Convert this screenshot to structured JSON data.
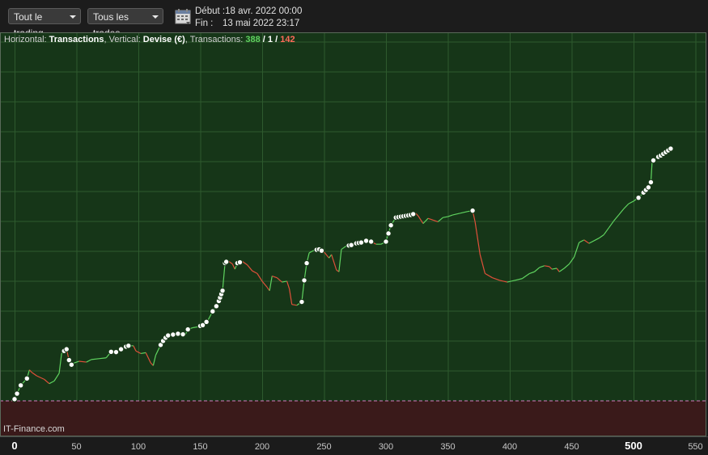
{
  "toolbar": {
    "trading_filter": "Tout le trading",
    "trades_filter": "Tous les trades",
    "start_label": "Début :",
    "start_value": "18 avr. 2022 00:00",
    "end_label": "Fin :",
    "end_value": "13 mai 2022 23:17"
  },
  "legend": {
    "h_label": "Horizontal: ",
    "h_value": "Transactions",
    "v_label": ", Vertical: ",
    "v_value": "Devise (€)",
    "t_label": ", Transactions: ",
    "wins": "388",
    "sep": " / ",
    "neutral": "1",
    "losses": "142"
  },
  "credit": "IT-Finance.com",
  "colors": {
    "background": "#163618",
    "negative_zone": "#3a1a1a",
    "rise": "#5fd35f",
    "fall": "#e0503a",
    "marker": "#ffffff"
  },
  "chart_data": {
    "type": "line",
    "xlabel": "",
    "ylabel": "",
    "xlim": [
      -10,
      560
    ],
    "x_ticks": [
      0,
      50,
      100,
      150,
      200,
      250,
      300,
      350,
      400,
      450,
      500,
      550
    ],
    "ylim": [
      -3,
      40
    ],
    "zero_line": 0,
    "grid": true,
    "points": [
      [
        0,
        0.2
      ],
      [
        5,
        1.8
      ],
      [
        10,
        2.6
      ],
      [
        12,
        3.6
      ],
      [
        14,
        3.3
      ],
      [
        18,
        2.9
      ],
      [
        24,
        2.5
      ],
      [
        28,
        2.0
      ],
      [
        32,
        2.3
      ],
      [
        36,
        3.2
      ],
      [
        38,
        5.5
      ],
      [
        40,
        5.8
      ],
      [
        42,
        6.0
      ],
      [
        45,
        4.1
      ],
      [
        48,
        4.4
      ],
      [
        52,
        4.6
      ],
      [
        58,
        4.5
      ],
      [
        62,
        4.8
      ],
      [
        68,
        4.9
      ],
      [
        74,
        5.0
      ],
      [
        78,
        5.7
      ],
      [
        80,
        5.5
      ],
      [
        86,
        6.0
      ],
      [
        90,
        6.3
      ],
      [
        92,
        6.4
      ],
      [
        96,
        6.4
      ],
      [
        98,
        5.8
      ],
      [
        102,
        5.5
      ],
      [
        106,
        5.6
      ],
      [
        110,
        4.4
      ],
      [
        112,
        4.1
      ],
      [
        114,
        5.3
      ],
      [
        118,
        6.5
      ],
      [
        121,
        7.2
      ],
      [
        124,
        7.6
      ],
      [
        128,
        7.7
      ],
      [
        132,
        7.8
      ],
      [
        138,
        7.7
      ],
      [
        140,
        8.3
      ],
      [
        144,
        8.5
      ],
      [
        148,
        8.6
      ],
      [
        152,
        8.8
      ],
      [
        156,
        9.3
      ],
      [
        160,
        10.4
      ],
      [
        164,
        11.2
      ],
      [
        168,
        12.8
      ],
      [
        170,
        16.0
      ],
      [
        172,
        16.3
      ],
      [
        176,
        15.9
      ],
      [
        178,
        15.3
      ],
      [
        180,
        16.0
      ],
      [
        184,
        16.2
      ],
      [
        188,
        15.8
      ],
      [
        192,
        15.1
      ],
      [
        196,
        14.8
      ],
      [
        200,
        13.9
      ],
      [
        204,
        13.2
      ],
      [
        206,
        12.8
      ],
      [
        208,
        14.5
      ],
      [
        212,
        14.3
      ],
      [
        216,
        13.8
      ],
      [
        220,
        13.9
      ],
      [
        222,
        13.0
      ],
      [
        224,
        11.2
      ],
      [
        228,
        11.1
      ],
      [
        232,
        11.5
      ],
      [
        234,
        14.0
      ],
      [
        236,
        16.0
      ],
      [
        238,
        17.2
      ],
      [
        242,
        17.5
      ],
      [
        246,
        17.6
      ],
      [
        250,
        17.3
      ],
      [
        254,
        16.6
      ],
      [
        256,
        17.0
      ],
      [
        260,
        15.2
      ],
      [
        262,
        15.0
      ],
      [
        264,
        17.6
      ],
      [
        268,
        18.0
      ],
      [
        272,
        18.1
      ],
      [
        276,
        18.3
      ],
      [
        280,
        18.4
      ],
      [
        284,
        18.6
      ],
      [
        288,
        18.5
      ],
      [
        292,
        18.2
      ],
      [
        296,
        18.2
      ],
      [
        300,
        18.5
      ],
      [
        304,
        20.4
      ],
      [
        308,
        21.3
      ],
      [
        312,
        21.4
      ],
      [
        316,
        21.5
      ],
      [
        320,
        21.6
      ],
      [
        324,
        21.8
      ],
      [
        326,
        21.5
      ],
      [
        330,
        20.6
      ],
      [
        334,
        21.2
      ],
      [
        338,
        21.0
      ],
      [
        342,
        20.8
      ],
      [
        346,
        21.3
      ],
      [
        350,
        21.4
      ],
      [
        354,
        21.6
      ],
      [
        360,
        21.8
      ],
      [
        366,
        22.0
      ],
      [
        370,
        22.1
      ],
      [
        372,
        20.8
      ],
      [
        376,
        17.0
      ],
      [
        380,
        14.8
      ],
      [
        386,
        14.3
      ],
      [
        392,
        14.0
      ],
      [
        398,
        13.8
      ],
      [
        404,
        14.0
      ],
      [
        410,
        14.2
      ],
      [
        416,
        14.8
      ],
      [
        420,
        15.0
      ],
      [
        424,
        15.5
      ],
      [
        428,
        15.7
      ],
      [
        432,
        15.6
      ],
      [
        434,
        15.3
      ],
      [
        438,
        15.4
      ],
      [
        440,
        15.0
      ],
      [
        444,
        15.4
      ],
      [
        448,
        15.9
      ],
      [
        452,
        16.7
      ],
      [
        456,
        18.4
      ],
      [
        460,
        18.7
      ],
      [
        464,
        18.3
      ],
      [
        468,
        18.6
      ],
      [
        472,
        18.9
      ],
      [
        476,
        19.3
      ],
      [
        480,
        20.1
      ],
      [
        484,
        20.9
      ],
      [
        488,
        21.6
      ],
      [
        492,
        22.3
      ],
      [
        496,
        22.9
      ],
      [
        500,
        23.2
      ],
      [
        504,
        23.6
      ],
      [
        508,
        24.2
      ],
      [
        512,
        24.8
      ],
      [
        514,
        25.4
      ],
      [
        515,
        27.8
      ],
      [
        518,
        28.2
      ],
      [
        522,
        28.5
      ],
      [
        526,
        28.9
      ],
      [
        530,
        29.3
      ]
    ],
    "markers": [
      0,
      2,
      5,
      10,
      40,
      42,
      44,
      46,
      78,
      82,
      86,
      90,
      92,
      118,
      120,
      122,
      124,
      128,
      132,
      136,
      140,
      150,
      152,
      155,
      160,
      163,
      165,
      166,
      167,
      168,
      170,
      171,
      180,
      182,
      232,
      234,
      236,
      244,
      246,
      248,
      270,
      272,
      276,
      278,
      280,
      284,
      288,
      300,
      302,
      304,
      308,
      310,
      312,
      314,
      316,
      318,
      320,
      322,
      370,
      504,
      508,
      510,
      512,
      514,
      516,
      520,
      522,
      524,
      526,
      528,
      530
    ]
  }
}
